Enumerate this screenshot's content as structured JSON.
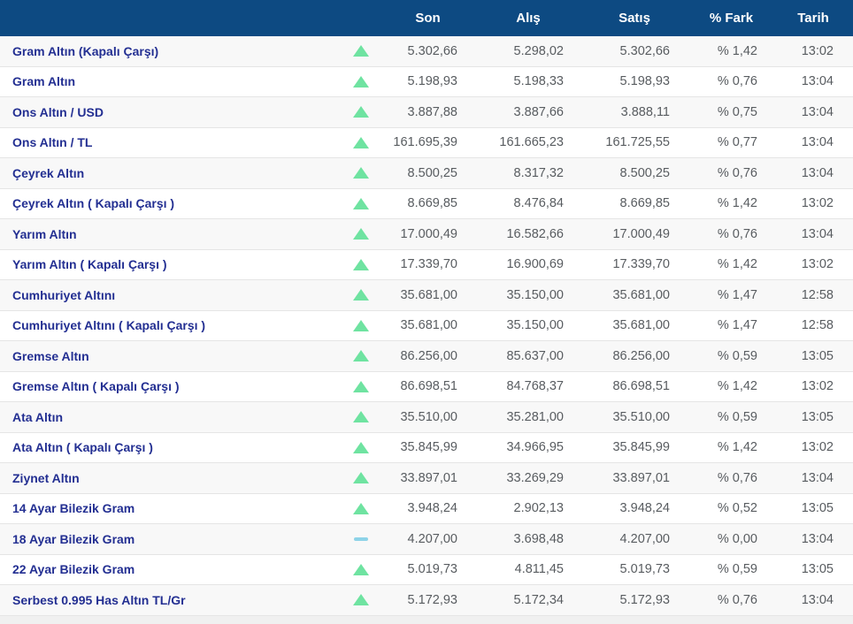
{
  "colors": {
    "header_bg": "#0d4a82",
    "header_text": "#ffffff",
    "row_label": "#232f92",
    "value_text": "#585c60",
    "row_alt_bg": "#f8f8f8",
    "row_bg": "#ffffff",
    "border": "#e5e5e5",
    "up": "#6fe3a1",
    "flat": "#8ed3e8",
    "footer_bg": "#f0f0f0"
  },
  "table": {
    "columns": [
      "Son",
      "Alış",
      "Satış",
      "% Fark",
      "Tarih"
    ],
    "rows": [
      {
        "name": "Gram Altın (Kapalı Çarşı)",
        "direction": "up",
        "son": "5.302,66",
        "alis": "5.298,02",
        "satis": "5.302,66",
        "fark": "% 1,42",
        "tarih": "13:02"
      },
      {
        "name": "Gram Altın",
        "direction": "up",
        "son": "5.198,93",
        "alis": "5.198,33",
        "satis": "5.198,93",
        "fark": "% 0,76",
        "tarih": "13:04"
      },
      {
        "name": "Ons Altın / USD",
        "direction": "up",
        "son": "3.887,88",
        "alis": "3.887,66",
        "satis": "3.888,11",
        "fark": "% 0,75",
        "tarih": "13:04"
      },
      {
        "name": "Ons Altın / TL",
        "direction": "up",
        "son": "161.695,39",
        "alis": "161.665,23",
        "satis": "161.725,55",
        "fark": "% 0,77",
        "tarih": "13:04"
      },
      {
        "name": "Çeyrek Altın",
        "direction": "up",
        "son": "8.500,25",
        "alis": "8.317,32",
        "satis": "8.500,25",
        "fark": "% 0,76",
        "tarih": "13:04"
      },
      {
        "name": "Çeyrek Altın ( Kapalı Çarşı )",
        "direction": "up",
        "son": "8.669,85",
        "alis": "8.476,84",
        "satis": "8.669,85",
        "fark": "% 1,42",
        "tarih": "13:02"
      },
      {
        "name": "Yarım Altın",
        "direction": "up",
        "son": "17.000,49",
        "alis": "16.582,66",
        "satis": "17.000,49",
        "fark": "% 0,76",
        "tarih": "13:04"
      },
      {
        "name": "Yarım Altın ( Kapalı Çarşı )",
        "direction": "up",
        "son": "17.339,70",
        "alis": "16.900,69",
        "satis": "17.339,70",
        "fark": "% 1,42",
        "tarih": "13:02"
      },
      {
        "name": "Cumhuriyet Altını",
        "direction": "up",
        "son": "35.681,00",
        "alis": "35.150,00",
        "satis": "35.681,00",
        "fark": "% 1,47",
        "tarih": "12:58"
      },
      {
        "name": "Cumhuriyet Altını ( Kapalı Çarşı )",
        "direction": "up",
        "son": "35.681,00",
        "alis": "35.150,00",
        "satis": "35.681,00",
        "fark": "% 1,47",
        "tarih": "12:58"
      },
      {
        "name": "Gremse Altın",
        "direction": "up",
        "son": "86.256,00",
        "alis": "85.637,00",
        "satis": "86.256,00",
        "fark": "% 0,59",
        "tarih": "13:05"
      },
      {
        "name": "Gremse Altın ( Kapalı Çarşı )",
        "direction": "up",
        "son": "86.698,51",
        "alis": "84.768,37",
        "satis": "86.698,51",
        "fark": "% 1,42",
        "tarih": "13:02"
      },
      {
        "name": "Ata Altın",
        "direction": "up",
        "son": "35.510,00",
        "alis": "35.281,00",
        "satis": "35.510,00",
        "fark": "% 0,59",
        "tarih": "13:05"
      },
      {
        "name": "Ata Altın ( Kapalı Çarşı )",
        "direction": "up",
        "son": "35.845,99",
        "alis": "34.966,95",
        "satis": "35.845,99",
        "fark": "% 1,42",
        "tarih": "13:02"
      },
      {
        "name": "Ziynet Altın",
        "direction": "up",
        "son": "33.897,01",
        "alis": "33.269,29",
        "satis": "33.897,01",
        "fark": "% 0,76",
        "tarih": "13:04"
      },
      {
        "name": "14 Ayar Bilezik Gram",
        "direction": "up",
        "son": "3.948,24",
        "alis": "2.902,13",
        "satis": "3.948,24",
        "fark": "% 0,52",
        "tarih": "13:05"
      },
      {
        "name": "18 Ayar Bilezik Gram",
        "direction": "flat",
        "son": "4.207,00",
        "alis": "3.698,48",
        "satis": "4.207,00",
        "fark": "% 0,00",
        "tarih": "13:04"
      },
      {
        "name": "22 Ayar Bilezik Gram",
        "direction": "up",
        "son": "5.019,73",
        "alis": "4.811,45",
        "satis": "5.019,73",
        "fark": "% 0,59",
        "tarih": "13:05"
      },
      {
        "name": "Serbest 0.995 Has Altın TL/Gr",
        "direction": "up",
        "son": "5.172,93",
        "alis": "5.172,34",
        "satis": "5.172,93",
        "fark": "% 0,76",
        "tarih": "13:04"
      }
    ]
  }
}
